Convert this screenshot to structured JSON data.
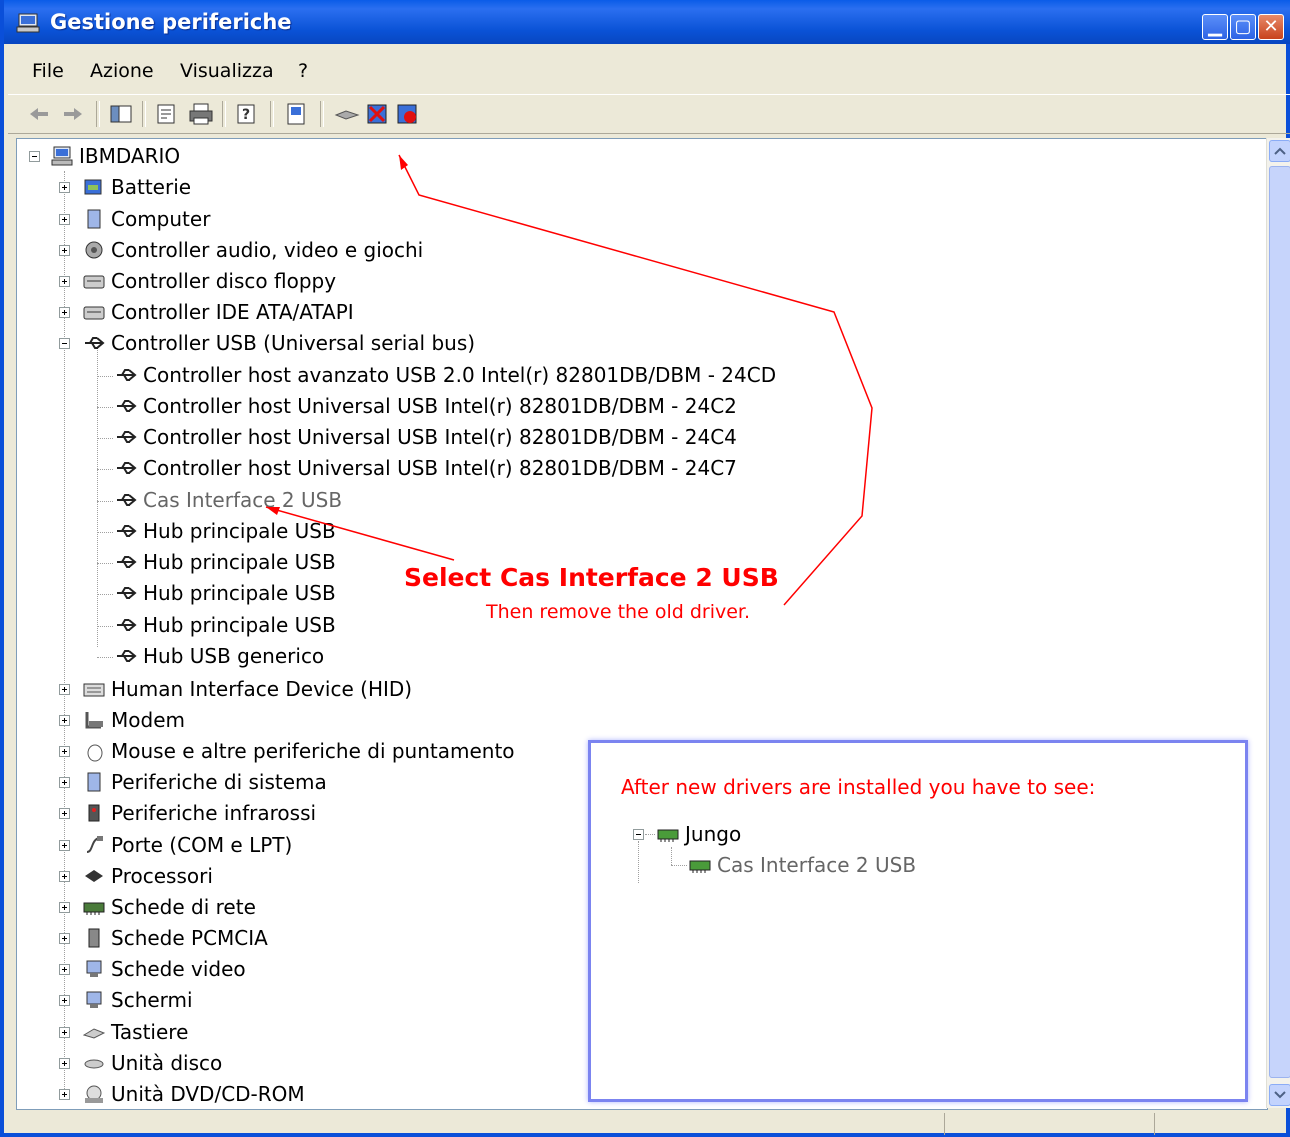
{
  "window": {
    "title": "Gestione periferiche"
  },
  "menu": [
    "File",
    "Azione",
    "Visualizza",
    "?"
  ],
  "toolbar_icons": [
    "back-arrow-icon",
    "forward-arrow-icon",
    "show-hide-tree-icon",
    "properties-icon",
    "print-icon",
    "help-icon",
    "scan-hardware-icon",
    "update-driver-icon",
    "uninstall-icon",
    "disable-icon"
  ],
  "tree": {
    "root": "IBMDARIO",
    "categories": [
      "Batterie",
      "Computer",
      "Controller audio, video e giochi",
      "Controller disco floppy",
      "Controller IDE ATA/ATAPI",
      "Controller USB (Universal serial bus)"
    ],
    "usb_children": [
      "Controller host avanzato USB 2.0 Intel(r) 82801DB/DBM - 24CD",
      "Controller host Universal USB Intel(r) 82801DB/DBM - 24C2",
      "Controller host Universal USB Intel(r) 82801DB/DBM - 24C4",
      "Controller host Universal USB Intel(r) 82801DB/DBM - 24C7",
      "Cas Interface 2 USB",
      "Hub principale USB",
      "Hub principale USB",
      "Hub principale USB",
      "Hub principale USB",
      "Hub USB generico"
    ],
    "categories_after": [
      "Human Interface Device (HID)",
      "Modem",
      "Mouse e altre periferiche di puntamento",
      "Periferiche di sistema",
      "Periferiche infrarossi",
      "Porte (COM e LPT)",
      "Processori",
      "Schede di rete",
      "Schede PCMCIA",
      "Schede video",
      "Schermi",
      "Tastiere",
      "Unità disco",
      "Unità DVD/CD-ROM"
    ]
  },
  "annotation": {
    "title": "Select Cas Interface 2 USB",
    "subtitle": "Then remove the old driver.",
    "after_title": "After new drivers are installed you have to see:",
    "after_parent": "Jungo",
    "after_child": "Cas Interface 2 USB",
    "color": "#ff0000"
  }
}
